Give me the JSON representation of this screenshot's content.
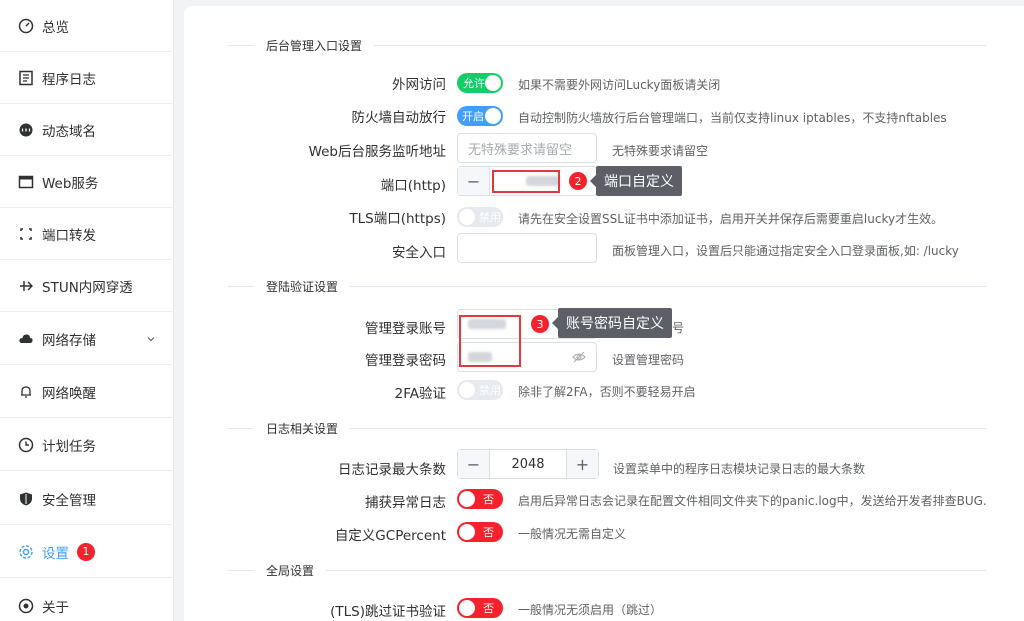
{
  "sidebar": {
    "items": [
      {
        "label": "总览",
        "icon": "dashboard-icon"
      },
      {
        "label": "程序日志",
        "icon": "log-icon"
      },
      {
        "label": "动态域名",
        "icon": "dns-icon"
      },
      {
        "label": "Web服务",
        "icon": "web-icon"
      },
      {
        "label": "端口转发",
        "icon": "port-forward-icon"
      },
      {
        "label": "STUN内网穿透",
        "icon": "stun-icon"
      },
      {
        "label": "网络存储",
        "icon": "cloud-icon"
      },
      {
        "label": "网络唤醒",
        "icon": "bell-icon"
      },
      {
        "label": "计划任务",
        "icon": "clock-icon"
      },
      {
        "label": "安全管理",
        "icon": "shield-icon"
      },
      {
        "label": "设置",
        "icon": "gear-icon",
        "badge": "1"
      },
      {
        "label": "关于",
        "icon": "about-icon"
      }
    ]
  },
  "sections": {
    "admin_entry": "后台管理入口设置",
    "login_auth": "登陆验证设置",
    "log": "日志相关设置",
    "global": "全局设置"
  },
  "fields": {
    "external_access": {
      "label": "外网访问",
      "switch": "允许",
      "hint": "如果不需要外网访问Lucky面板请关闭"
    },
    "firewall": {
      "label": "防火墙自动放行",
      "switch": "开启",
      "hint": "自动控制防火墙放行后台管理端口，当前仅支持linux iptables，不支持nftables"
    },
    "listen_addr": {
      "label": "Web后台服务监听地址",
      "placeholder": "无特殊要求请留空",
      "hint": "无特殊要求请留空"
    },
    "port_http": {
      "label": "端口(http)",
      "minus": "−"
    },
    "tls_port": {
      "label": "TLS端口(https)",
      "switch": "禁用",
      "hint": "请先在安全设置SSL证书中添加证书，启用开关并保存后需要重启lucky才生效。"
    },
    "safe_entry": {
      "label": "安全入口",
      "hint": "面板管理入口，设置后只能通过指定安全入口登录面板,如: /lucky"
    },
    "admin_account": {
      "label": "管理登录账号",
      "hint_tail": "号"
    },
    "admin_password": {
      "label": "管理登录密码",
      "hint": "设置管理密码"
    },
    "twofa": {
      "label": "2FA验证",
      "switch": "禁用",
      "hint": "除非了解2FA，否则不要轻易开启"
    },
    "log_max": {
      "label": "日志记录最大条数",
      "value": "2048",
      "minus": "−",
      "plus": "+",
      "hint": "设置菜单中的程序日志模块记录日志的最大条数"
    },
    "panic_log": {
      "label": "捕获异常日志",
      "switch": "否",
      "hint": "启用后异常日志会记录在配置文件相同文件夹下的panic.log中，发送给开发者排查BUG."
    },
    "gc_percent": {
      "label": "自定义GCPercent",
      "switch": "否",
      "hint": "一般情况无需自定义"
    },
    "tls_skip": {
      "label": "(TLS)跳过证书验证",
      "switch": "否",
      "hint": "一般情况无须启用（跳过）"
    }
  },
  "callouts": [
    {
      "num": "2",
      "text": "端口自定义"
    },
    {
      "num": "3",
      "text": "账号密码自定义"
    }
  ],
  "colors": {
    "accent": "#409eff",
    "switch_on": "#13ce66",
    "switch_no": "#f5222d",
    "callout_bg": "#5c5f66"
  }
}
